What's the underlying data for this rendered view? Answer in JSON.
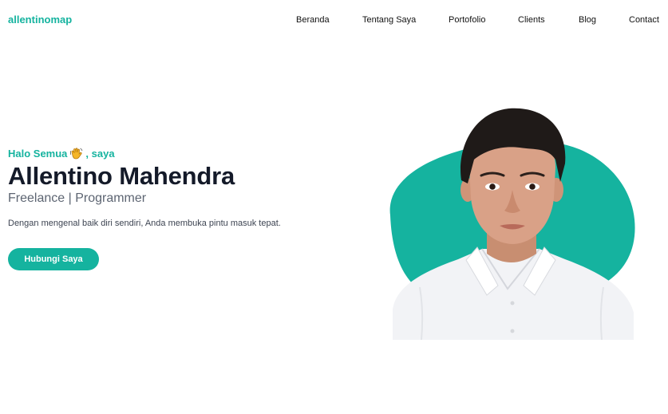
{
  "brand": {
    "name": "allentinomap"
  },
  "nav": {
    "items": [
      "Beranda",
      "Tentang Saya",
      "Portofolio",
      "Clients",
      "Blog",
      "Contact"
    ]
  },
  "hero": {
    "greeting_prefix": "Halo Semua",
    "greeting_suffix": ", saya",
    "greeting_icon": "waving-hand-icon",
    "name": "Allentino Mahendra",
    "role": "Freelance | Programmer",
    "description": "Dengan mengenal baik diri sendiri, Anda membuka pintu masuk tepat.",
    "cta_label": "Hubungi Saya",
    "photo_icon": "profile-photo"
  },
  "colors": {
    "accent": "#15b39f",
    "heading": "#141a29",
    "muted": "#5d6572"
  }
}
